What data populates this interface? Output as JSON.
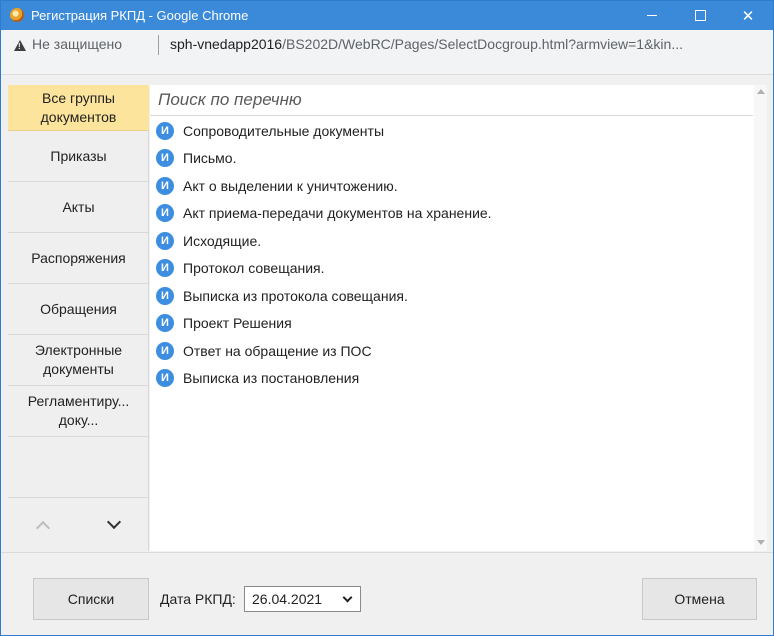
{
  "window": {
    "title": "Регистрация РКПД - Google Chrome"
  },
  "addressbar": {
    "security_text": "Не защищено",
    "url_host": "sph-vnedapp2016",
    "url_path": "/BS202D/WebRC/Pages/SelectDocgroup.html?armview=1&kin..."
  },
  "sidebar": {
    "items": [
      {
        "label": "Все группы документов"
      },
      {
        "label": "Приказы"
      },
      {
        "label": "Акты"
      },
      {
        "label": "Распоряжения"
      },
      {
        "label": "Обращения"
      },
      {
        "label": "Электронные документы"
      },
      {
        "label": "Регламентиру... доку..."
      }
    ]
  },
  "search": {
    "placeholder": "Поиск по перечню",
    "value": ""
  },
  "documents": {
    "icon_letter": "И",
    "items": [
      "Сопроводительные документы",
      "Письмо.",
      "Акт о выделении к уничтожению.",
      "Акт приема-передачи документов на хранение.",
      "Исходящие.",
      "Протокол совещания.",
      "Выписка из протокола совещания.",
      "Проект Решения",
      "Ответ на обращение из ПОС",
      "Выписка из постановления"
    ]
  },
  "footer": {
    "lists_label": "Списки",
    "date_label": "Дата РКПД:",
    "date_value": "26.04.2021",
    "cancel_label": "Отмена"
  },
  "colors": {
    "titlebar": "#3b8ad9",
    "active_item": "#fde49c",
    "doc_icon": "#3d8ee0"
  }
}
